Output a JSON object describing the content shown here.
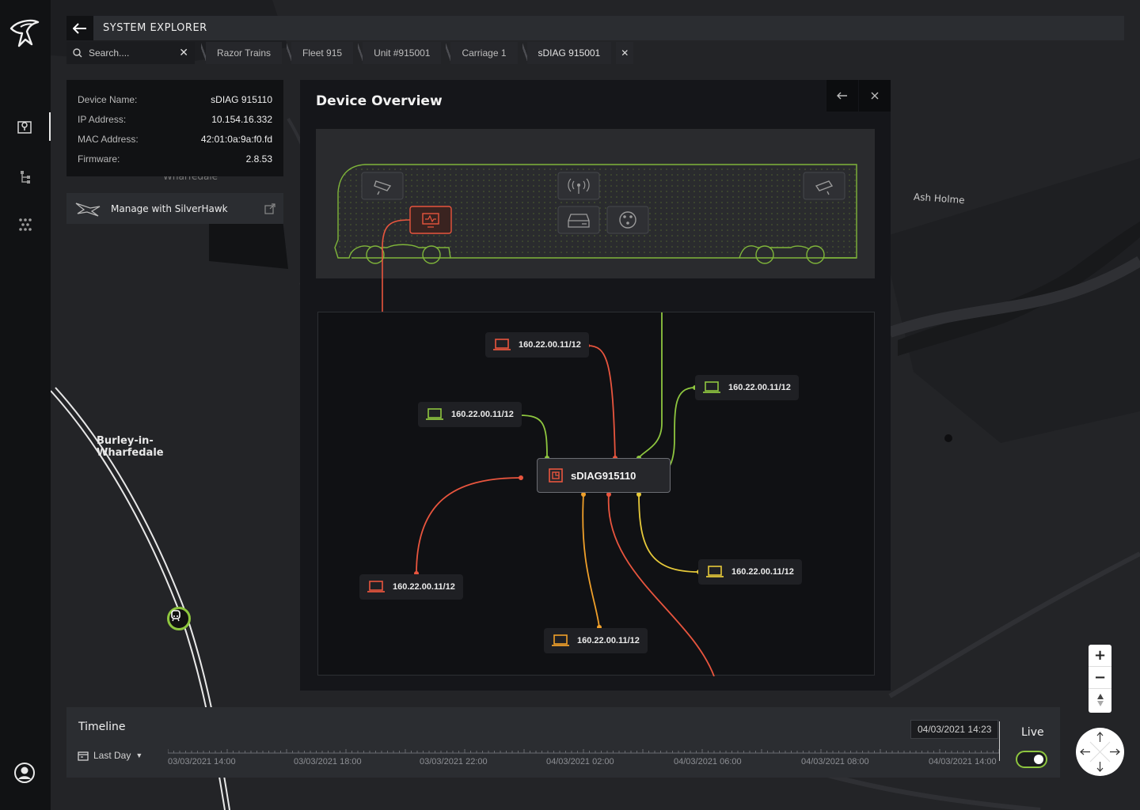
{
  "header": {
    "title": "SYSTEM EXPLORER"
  },
  "search": {
    "placeholder": "Search...."
  },
  "breadcrumbs": [
    "Razor Trains",
    "Fleet 915",
    "Unit #915001",
    "Carriage 1",
    "sDIAG 915001"
  ],
  "device_info": {
    "rows": [
      {
        "key": "Device Name:",
        "value": "sDIAG 915110"
      },
      {
        "key": "IP Address:",
        "value": "10.154.16.332"
      },
      {
        "key": "MAC Address:",
        "value": "42:01:0a:9a:f0.fd"
      },
      {
        "key": "Firmware:",
        "value": "2.8.53"
      }
    ]
  },
  "manage": {
    "label": "Manage with SilverHawk"
  },
  "panel": {
    "title": "Device Overview",
    "hub_name": "sDIAG915110",
    "nodes": [
      {
        "ip": "160.22.00.11/12",
        "status": "red"
      },
      {
        "ip": "160.22.00.11/12",
        "status": "green"
      },
      {
        "ip": "160.22.00.11/12",
        "status": "green"
      },
      {
        "ip": "160.22.00.11/12",
        "status": "red"
      },
      {
        "ip": "160.22.00.11/12",
        "status": "yellow"
      },
      {
        "ip": "160.22.00.11/12",
        "status": "orange"
      }
    ]
  },
  "map": {
    "labels": {
      "ash_holme": "Ash Holme",
      "burley": "Burley-in-\nWharfedale",
      "wharfedale_partial": "Wharfedale"
    }
  },
  "timeline": {
    "title": "Timeline",
    "range": "Last Day",
    "current": "04/03/2021 14:23",
    "live_label": "Live",
    "live_on": true,
    "tick_labels": [
      "03/03/2021 14:00",
      "03/03/2021 18:00",
      "03/03/2021 22:00",
      "04/03/2021 02:00",
      "04/03/2021 06:00",
      "04/03/2021 08:00",
      "04/03/2021 14:00"
    ]
  },
  "zoom": {
    "in": "+",
    "out": "−"
  },
  "colors": {
    "green": "#8ec63f",
    "red": "#e8553e",
    "yellow": "#e6c93a",
    "orange": "#f0a02a",
    "panel": "#15161a"
  }
}
